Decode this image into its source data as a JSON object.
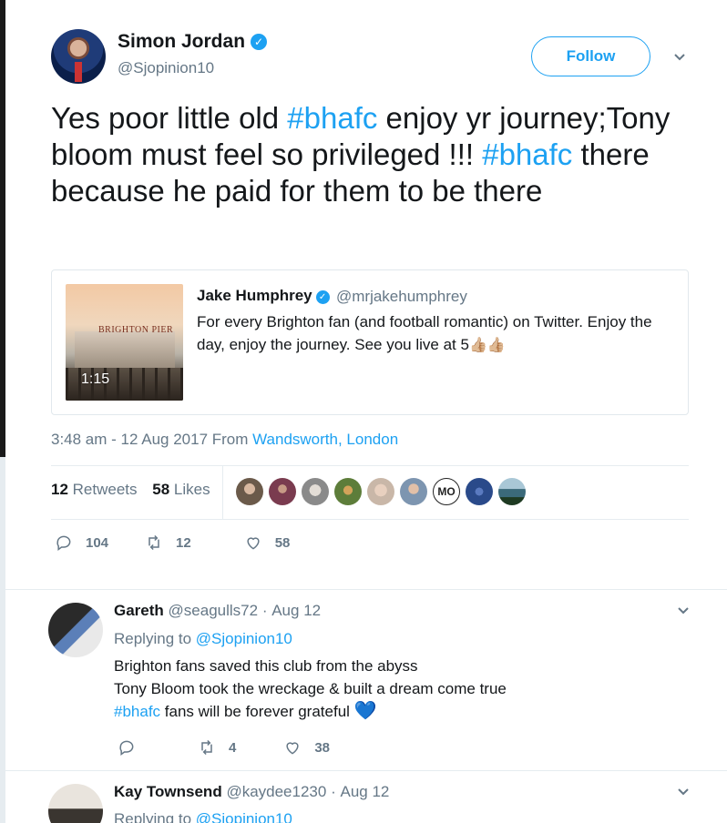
{
  "tweet": {
    "author_name": "Simon Jordan",
    "author_handle": "@Sjopinion10",
    "follow_label": "Follow",
    "text_parts": [
      "Yes poor little old ",
      "#bhafc",
      " enjoy yr journey;Tony bloom must feel so privileged !!! ",
      "#bhafc",
      " there because he paid for them to be there"
    ],
    "timestamp": "3:48 am - 12 Aug 2017 From ",
    "location": "Wandsworth, London",
    "retweets_count": "12",
    "retweets_label": "Retweets",
    "likes_count": "58",
    "likes_label": "Likes",
    "actions": {
      "replies": "104",
      "retweets": "12",
      "likes": "58"
    }
  },
  "quote": {
    "author_name": "Jake Humphrey",
    "author_handle": "@mrjakehumphrey",
    "text": "For every Brighton fan (and football romantic) on Twitter. Enjoy the day, enjoy the journey. See you live at 5",
    "emoji": "👍🏼👍🏼",
    "video_duration": "1:15",
    "thumb_sign": "BRIGHTON PIER"
  },
  "likers": [
    {
      "color": "#6b5a4a"
    },
    {
      "color": "#7a3b4f"
    },
    {
      "color": "#8a8a8a"
    },
    {
      "color": "#5d7d3a"
    },
    {
      "color": "#c9b7a8"
    },
    {
      "color": "#7d95b0"
    },
    {
      "label": "MO",
      "color": "#ffffff"
    },
    {
      "color": "#2a4a8a"
    },
    {
      "color": "#3b6a7a"
    }
  ],
  "replies": [
    {
      "name": "Gareth",
      "handle": "@seagulls72",
      "date": "Aug 12",
      "replying_prefix": "Replying to ",
      "replying_to": "@Sjopinion10",
      "line1": "Brighton fans saved this club from the abyss",
      "line2": "Tony Bloom took the wreckage & built a dream come true",
      "hashtag": "#bhafc",
      "line3": " fans will be forever grateful ",
      "heart": "💙",
      "actions": {
        "retweets": "4",
        "likes": "38"
      }
    },
    {
      "name": "Kay Townsend",
      "handle": "@kaydee1230",
      "date": "Aug 12",
      "replying_prefix": "Replying to ",
      "replying_to": "@Sjopinion10"
    }
  ],
  "colors": {
    "accent": "#1da1f2",
    "muted": "#657786",
    "text": "#14171a",
    "border": "#e6ecf0"
  }
}
